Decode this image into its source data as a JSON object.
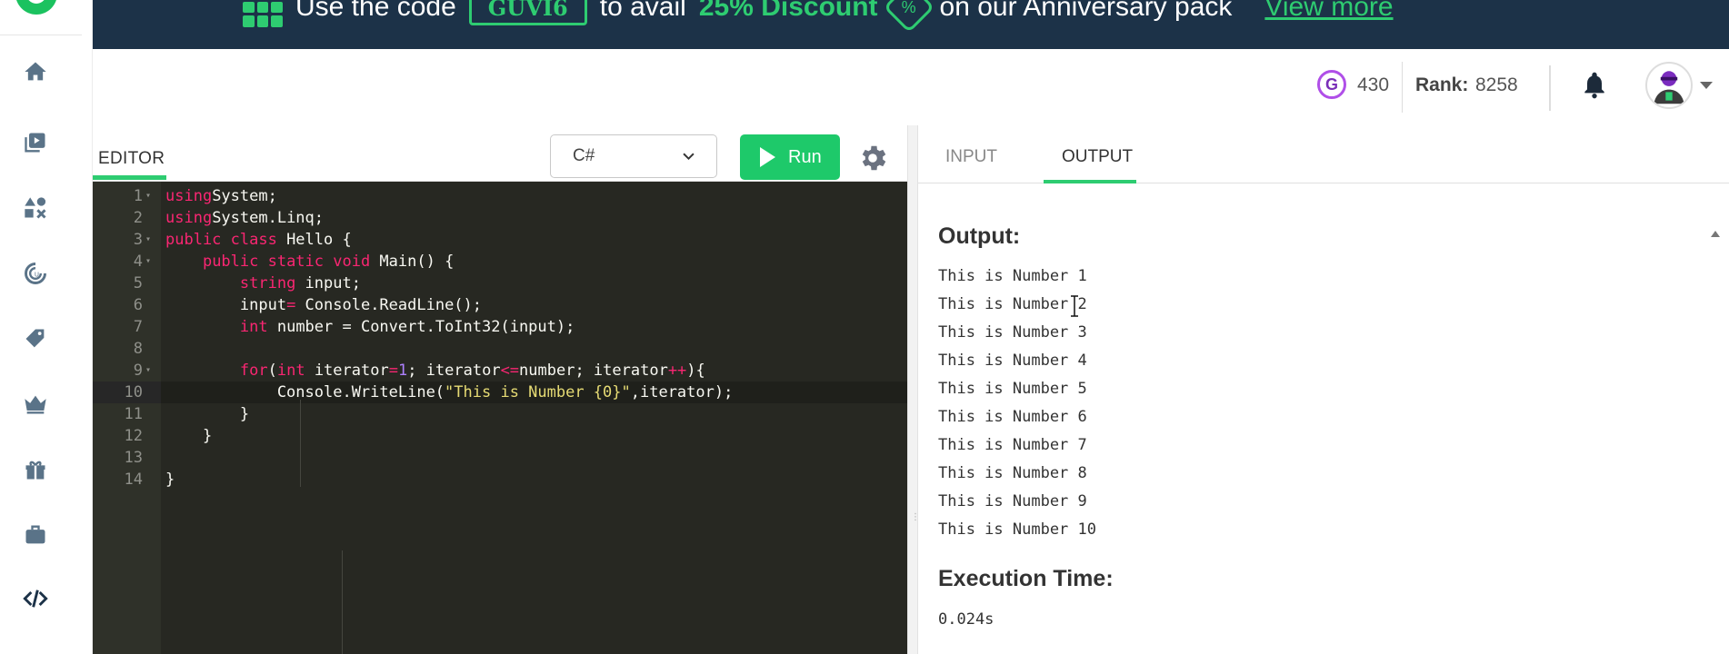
{
  "banner": {
    "prefix": "Use the code",
    "code": "GUVI6",
    "middle": "to avail",
    "discount": "25% Discount",
    "badge": "%",
    "suffix": "on our Anniversary pack",
    "link": "View more"
  },
  "header": {
    "gems": "430",
    "rank_label": "Rank:",
    "rank_value": "8258"
  },
  "editor": {
    "tab_label": "EDITOR",
    "language": "C#",
    "run_label": "Run",
    "active_line": 10,
    "lines": [
      {
        "n": "1",
        "fold": true
      },
      {
        "n": "2",
        "fold": false
      },
      {
        "n": "3",
        "fold": true
      },
      {
        "n": "4",
        "fold": true
      },
      {
        "n": "5",
        "fold": false
      },
      {
        "n": "6",
        "fold": false
      },
      {
        "n": "7",
        "fold": false
      },
      {
        "n": "8",
        "fold": false
      },
      {
        "n": "9",
        "fold": true
      },
      {
        "n": "10",
        "fold": false
      },
      {
        "n": "11",
        "fold": false
      },
      {
        "n": "12",
        "fold": false
      },
      {
        "n": "13",
        "fold": false
      },
      {
        "n": "14",
        "fold": false
      }
    ],
    "code": [
      [
        [
          "kw",
          "using"
        ],
        [
          "",
          "System;"
        ]
      ],
      [
        [
          "kw",
          "using"
        ],
        [
          "",
          "System.Linq;"
        ]
      ],
      [
        [
          "kw",
          "public class"
        ],
        [
          "",
          " Hello {"
        ]
      ],
      [
        [
          "",
          "    "
        ],
        [
          "kw",
          "public static void"
        ],
        [
          "",
          " Main() {"
        ]
      ],
      [
        [
          "",
          "        "
        ],
        [
          "ty",
          "string"
        ],
        [
          "",
          " input;"
        ]
      ],
      [
        [
          "",
          "        input"
        ],
        [
          "op",
          "="
        ],
        [
          "",
          " Console.ReadLine();"
        ]
      ],
      [
        [
          "",
          "        "
        ],
        [
          "ty",
          "int"
        ],
        [
          "",
          " number = Convert.ToInt32(input);"
        ]
      ],
      [
        [
          "",
          ""
        ]
      ],
      [
        [
          "",
          "        "
        ],
        [
          "kw",
          "for"
        ],
        [
          "",
          "("
        ],
        [
          "ty",
          "int"
        ],
        [
          "",
          " iterator"
        ],
        [
          "op",
          "="
        ],
        [
          "num",
          "1"
        ],
        [
          "",
          "; iterator"
        ],
        [
          "op",
          "<="
        ],
        [
          "",
          "number; iterator"
        ],
        [
          "op",
          "++"
        ],
        [
          "",
          "){"
        ]
      ],
      [
        [
          "",
          "            Console.WriteLine("
        ],
        [
          "str",
          "\"This is Number {0}\""
        ],
        [
          "",
          ",iterator);"
        ]
      ],
      [
        [
          "",
          "        }"
        ]
      ],
      [
        [
          "",
          "    }"
        ]
      ],
      [
        [
          "",
          ""
        ]
      ],
      [
        [
          "",
          "}"
        ]
      ]
    ]
  },
  "output_panel": {
    "tab_input": "INPUT",
    "tab_output": "OUTPUT",
    "output_heading": "Output:",
    "output_lines": [
      "This is Number 1",
      "This is Number 2",
      "This is Number 3",
      "This is Number 4",
      "This is Number 5",
      "This is Number 6",
      "This is Number 7",
      "This is Number 8",
      "This is Number 9",
      "This is Number 10"
    ],
    "exec_heading": "Execution Time:",
    "exec_time": "0.024s"
  },
  "colors": {
    "accent_green": "#2ecc71",
    "banner_bg": "#1c3248",
    "editor_bg": "#272822",
    "keyword": "#f92672",
    "string": "#e6db74",
    "number": "#ae81ff"
  },
  "icons": {
    "sidebar": [
      "home-icon",
      "video-library-icon",
      "shapes-icon",
      "progress-icon",
      "tag-icon",
      "crown-icon",
      "gift-icon",
      "briefcase-icon",
      "code-icon"
    ],
    "header": [
      "gem-icon",
      "bell-icon",
      "avatar-icon",
      "caret-down-icon"
    ],
    "editor": [
      "play-icon",
      "gear-icon",
      "chevron-down-icon"
    ]
  }
}
